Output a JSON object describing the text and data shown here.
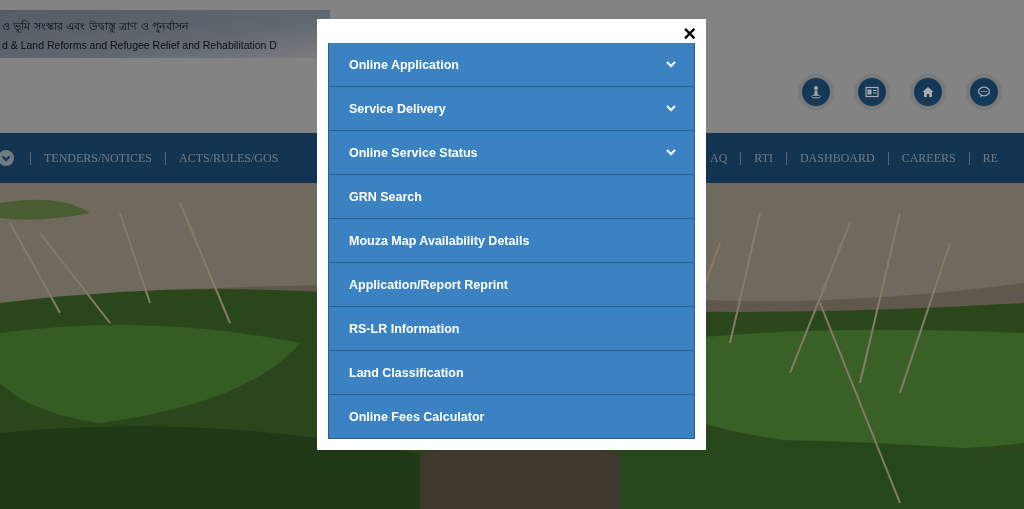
{
  "banner": {
    "title_bn": "ও ভূমি সংস্কার এবং উদ্বাস্তু ত্রাণ ও পুনর্বাসন",
    "title_en": "d & Land Reforms and Refugee Relief and Rehabilitation D"
  },
  "nav": {
    "left": [
      "TENDERS/NOTICES",
      "ACTS/RULES/GOS"
    ],
    "right": [
      "AQ",
      "RTI",
      "DASHBOARD",
      "CAREERS",
      "RE"
    ]
  },
  "modal": {
    "close": "×",
    "items": [
      {
        "label": "Online Application",
        "expandable": true
      },
      {
        "label": "Service Delivery",
        "expandable": true
      },
      {
        "label": "Online Service Status",
        "expandable": true
      },
      {
        "label": "GRN Search",
        "expandable": false
      },
      {
        "label": "Mouza Map Availability Details",
        "expandable": false
      },
      {
        "label": "Application/Report Reprint",
        "expandable": false
      },
      {
        "label": "RS-LR Information",
        "expandable": false
      },
      {
        "label": "Land Classification",
        "expandable": false
      },
      {
        "label": "Online Fees Calculator",
        "expandable": false
      }
    ]
  }
}
